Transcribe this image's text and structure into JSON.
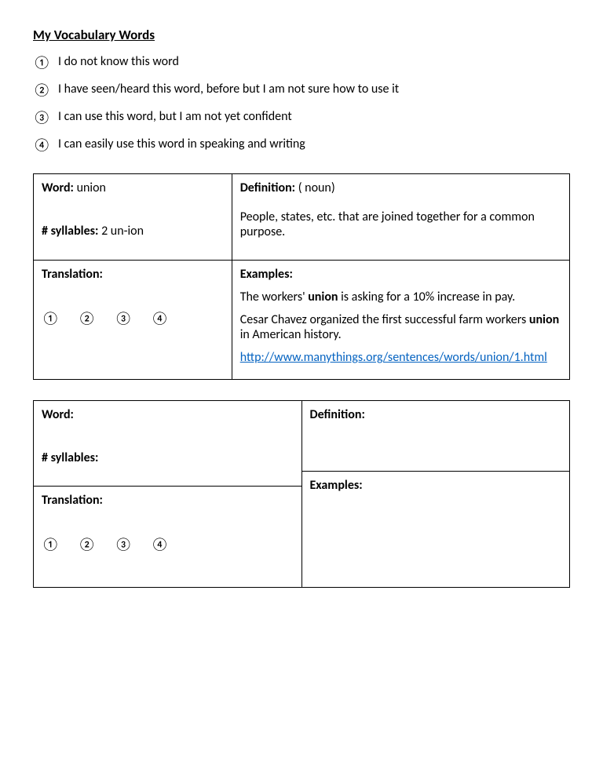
{
  "title": "My Vocabulary Words",
  "legend": [
    {
      "num": "①",
      "text": "I do not know this word"
    },
    {
      "num": "②",
      "text": "I have seen/heard this word, before but I am not sure how to use it"
    },
    {
      "num": "③",
      "text": "I can use this word, but I am not yet confident"
    },
    {
      "num": "④",
      "text": "I can easily use this word in speaking and writing"
    }
  ],
  "labels": {
    "word": "Word:",
    "definition": "Definition:",
    "syllables": "# syllables:",
    "translation": "Translation:",
    "examples": "Examples:"
  },
  "circled": [
    "①",
    "②",
    "③",
    "④"
  ],
  "entry1": {
    "word": "union",
    "syllables": "2  un-ion",
    "translation": "",
    "definition_pos": "( noun)",
    "definition_text": "People, states, etc. that are joined together for a common purpose.",
    "example1_pre": "The workers' ",
    "example1_bold": "union",
    "example1_post": " is asking for a 10% increase in pay.",
    "example2_pre": "Cesar Chavez organized the first successful farm workers ",
    "example2_bold": "union",
    "example2_post": " in American history.",
    "link": "http://www.manythings.org/sentences/words/union/1.html"
  },
  "entry2": {
    "word": "",
    "syllables": "",
    "translation": "",
    "definition": "",
    "examples": ""
  }
}
